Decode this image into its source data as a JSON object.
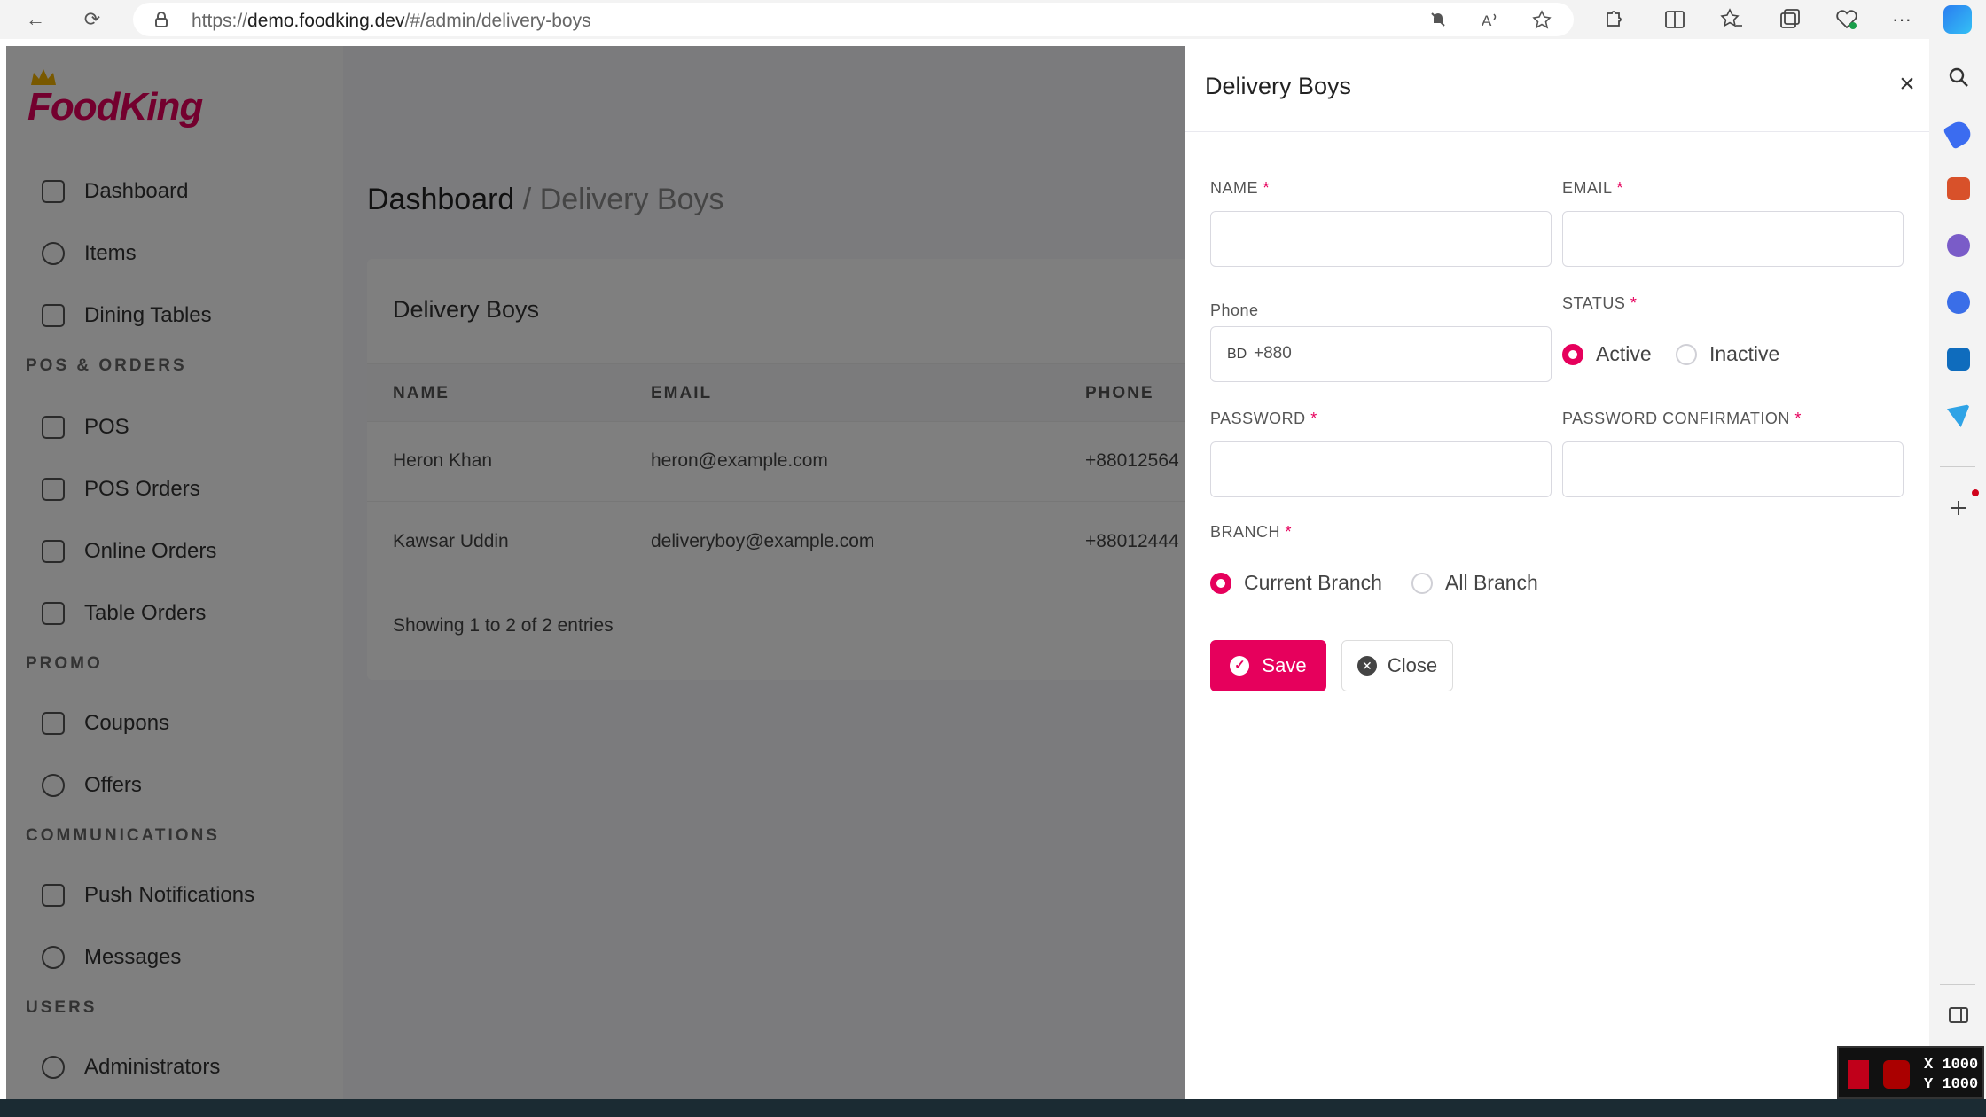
{
  "browser": {
    "url_prefix": "https://",
    "url_host": "demo.foodking.dev",
    "url_path": "/#/admin/delivery-boys",
    "back_icon": "←",
    "reload_icon": "⟳",
    "more_icon": "···"
  },
  "app": {
    "logo": "FoodKing"
  },
  "sidebar": {
    "items": [
      {
        "label": "Dashboard"
      },
      {
        "label": "Items"
      },
      {
        "label": "Dining Tables"
      },
      {
        "label": "POS"
      },
      {
        "label": "POS Orders"
      },
      {
        "label": "Online Orders"
      },
      {
        "label": "Table Orders"
      },
      {
        "label": "Coupons"
      },
      {
        "label": "Offers"
      },
      {
        "label": "Push Notifications"
      },
      {
        "label": "Messages"
      },
      {
        "label": "Administrators"
      }
    ],
    "sections": [
      "POS & ORDERS",
      "PROMO",
      "COMMUNICATIONS",
      "USERS"
    ]
  },
  "breadcrumb": {
    "home": "Dashboard",
    "separator": " / ",
    "current": "Delivery Boys"
  },
  "list": {
    "title": "Delivery Boys",
    "columns": [
      "NAME",
      "EMAIL",
      "PHONE"
    ],
    "rows": [
      {
        "name": "Heron Khan",
        "email": "heron@example.com",
        "phone": "+88012564"
      },
      {
        "name": "Kawsar Uddin",
        "email": "deliveryboy@example.com",
        "phone": "+88012444"
      }
    ],
    "showing": "Showing 1 to 2 of 2 entries"
  },
  "drawer": {
    "title": "Delivery Boys",
    "close_icon": "×",
    "name_label": "NAME",
    "email_label": "EMAIL",
    "phone_label": "Phone",
    "phone_country": "BD",
    "phone_prefix": "+880",
    "status_label": "STATUS",
    "status_options": [
      "Active",
      "Inactive"
    ],
    "status_selected": "Active",
    "password_label": "PASSWORD",
    "password_confirm_label": "PASSWORD CONFIRMATION",
    "branch_label": "BRANCH",
    "branch_options": [
      "Current Branch",
      "All Branch"
    ],
    "branch_selected": "Current Branch",
    "required_mark": "*",
    "save_label": "Save",
    "close_label": "Close"
  },
  "overlay_widget": {
    "x": "X 1000",
    "y": "Y 1000"
  },
  "colors": {
    "accent": "#e6005c",
    "overlay": "rgba(0,0,0,0.5)"
  }
}
